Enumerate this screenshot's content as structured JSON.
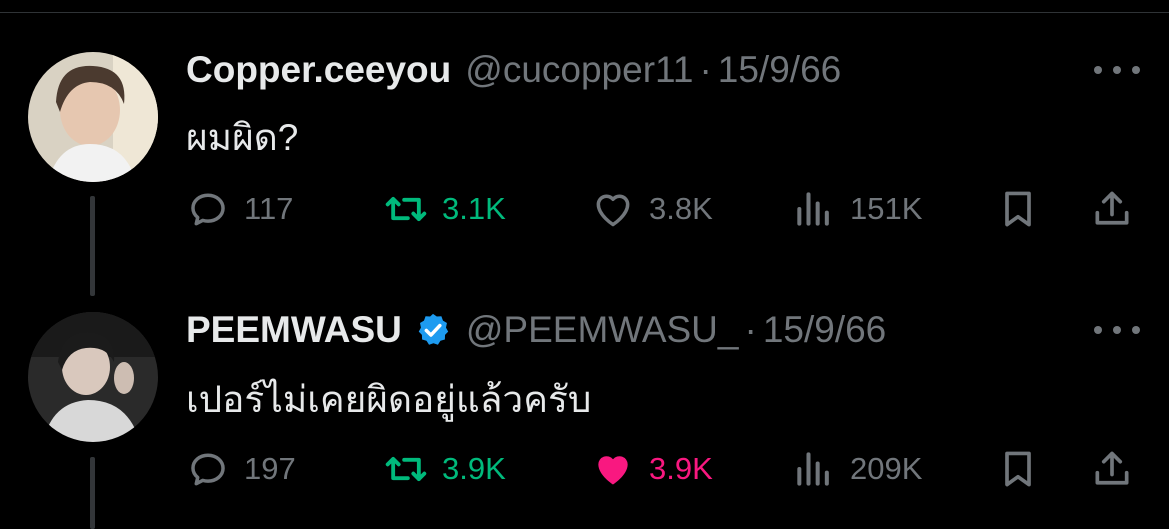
{
  "tweets": [
    {
      "display_name": "Copper.ceeyou",
      "handle": "@cucopper11",
      "separator": "·",
      "date": "15/9/66",
      "text": "ผมผิด?",
      "verified": false,
      "counts": {
        "replies": "117",
        "retweets": "3.1K",
        "likes": "3.8K",
        "views": "151K"
      },
      "liked": false
    },
    {
      "display_name": "PEEMWASU",
      "handle": "@PEEMWASU_",
      "separator": "·",
      "date": "15/9/66",
      "text": "เปอร์ไม่เคยผิดอยู่แล้วครับ",
      "verified": true,
      "counts": {
        "replies": "197",
        "retweets": "3.9K",
        "likes": "3.9K",
        "views": "209K"
      },
      "liked": true
    }
  ],
  "colors": {
    "background": "#000000",
    "text_primary": "#e7e9ea",
    "text_secondary": "#71767b",
    "retweet_active": "#00ba7c",
    "like_active": "#f91880",
    "verified_badge": "#1d9bf0"
  },
  "icons": [
    "reply-icon",
    "retweet-icon",
    "like-icon",
    "views-icon",
    "bookmark-icon",
    "share-icon",
    "more-icon",
    "verified-badge-icon"
  ]
}
